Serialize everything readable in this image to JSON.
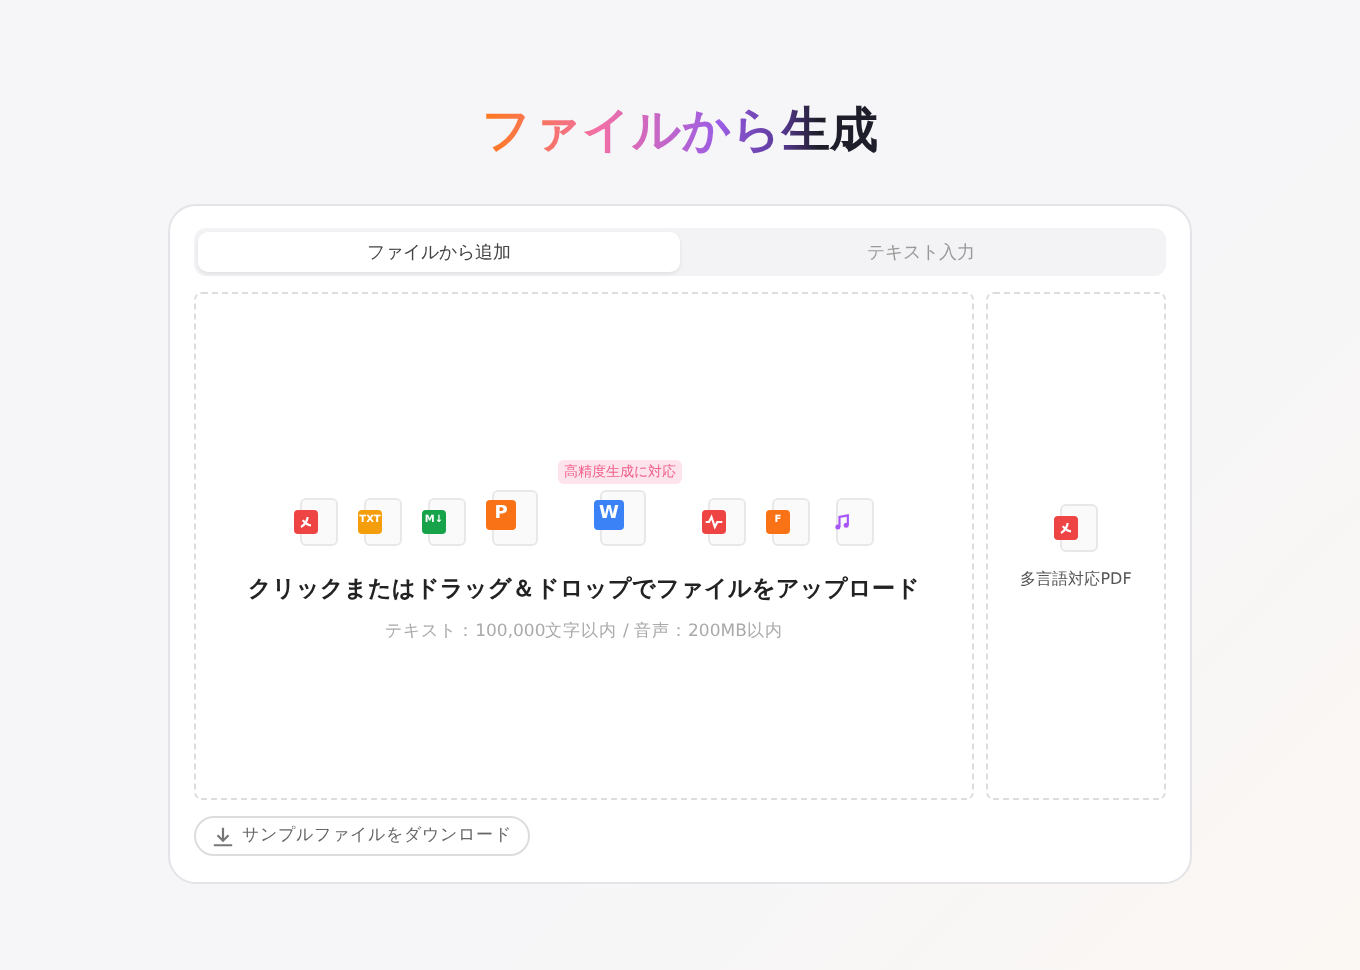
{
  "title": "ファイルから生成",
  "tabs": [
    {
      "label": "ファイルから追加",
      "selected": true
    },
    {
      "label": "テキスト入力",
      "selected": false
    }
  ],
  "upload": {
    "badge": "高精度生成に対応",
    "file_types": [
      {
        "kind": "pdf",
        "color": "#ef4444"
      },
      {
        "kind": "letter",
        "label": "TXT",
        "color": "#f59e0b"
      },
      {
        "kind": "letter",
        "label": "M↓",
        "color": "#16a34a"
      },
      {
        "kind": "letter",
        "label": "P",
        "color": "#f97316",
        "large": true
      },
      {
        "kind": "letter",
        "label": "W",
        "color": "#3b82f6",
        "large": true
      },
      {
        "kind": "wave",
        "color": "#ef4444"
      },
      {
        "kind": "letter",
        "label": "F",
        "color": "#f97316"
      },
      {
        "kind": "music",
        "color": "#a855f7"
      }
    ],
    "instruction": "クリックまたはドラッグ＆ドロップでファイルをアップロード",
    "limits": "テキスト：100,000文字以内 / 音声：200MB以内"
  },
  "side_panel": {
    "label": "多言語対応PDF"
  },
  "sample_button": "サンプルファイルをダウンロード"
}
